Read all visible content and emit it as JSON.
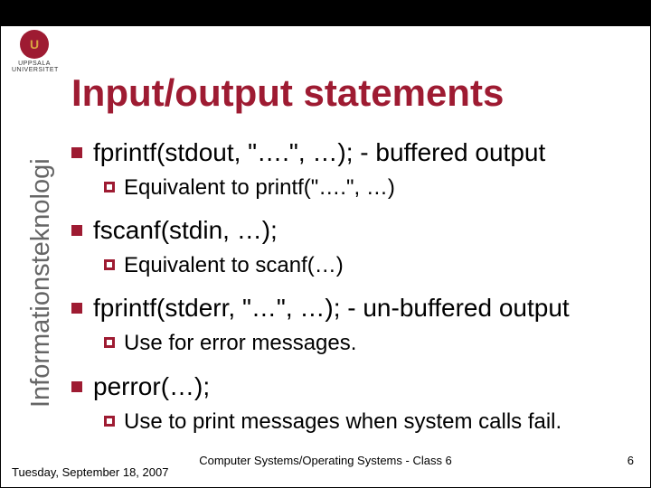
{
  "logo": {
    "short": "U",
    "name": "UPPSALA\nUNIVERSITET"
  },
  "title": "Input/output statements",
  "side_label": "Informationsteknologi",
  "bullets": [
    {
      "text": "fprintf(stdout, \"….\", …); - buffered output",
      "sub": [
        "Equivalent to printf(\"….\", …)"
      ]
    },
    {
      "text": "fscanf(stdin, …);",
      "sub": [
        "Equivalent to scanf(…)"
      ]
    },
    {
      "text": "fprintf(stderr, \"…\", …); - un-buffered output",
      "sub": [
        "Use for error messages."
      ]
    },
    {
      "text": "perror(…);",
      "sub": [
        "Use to print messages when system calls fail."
      ]
    }
  ],
  "footer": {
    "date": "Tuesday, September 18, 2007",
    "center": "Computer Systems/Operating Systems - Class 6",
    "page": "6"
  }
}
